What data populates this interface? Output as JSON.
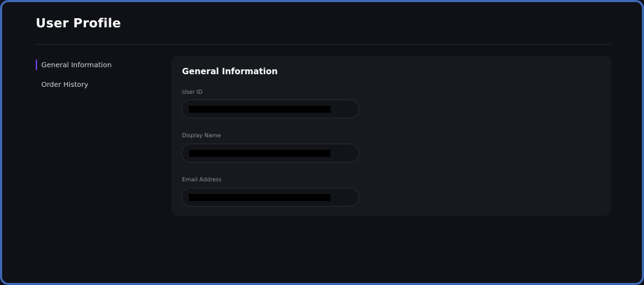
{
  "header": {
    "title": "User Profile"
  },
  "sidebar": {
    "items": [
      {
        "label": "General Information",
        "active": true
      },
      {
        "label": "Order History",
        "active": false
      }
    ],
    "accent_color": "#6b3fe0"
  },
  "section": {
    "title": "General Information",
    "fields": [
      {
        "label": "User ID",
        "value": "",
        "redacted": true
      },
      {
        "label": "Display Name",
        "value": "",
        "redacted": true
      },
      {
        "label": "Email Address",
        "value": "",
        "redacted": true
      }
    ]
  },
  "theme": {
    "background": "#0f1116",
    "card_background": "#17191e",
    "frame_border": "#3f67b8"
  }
}
